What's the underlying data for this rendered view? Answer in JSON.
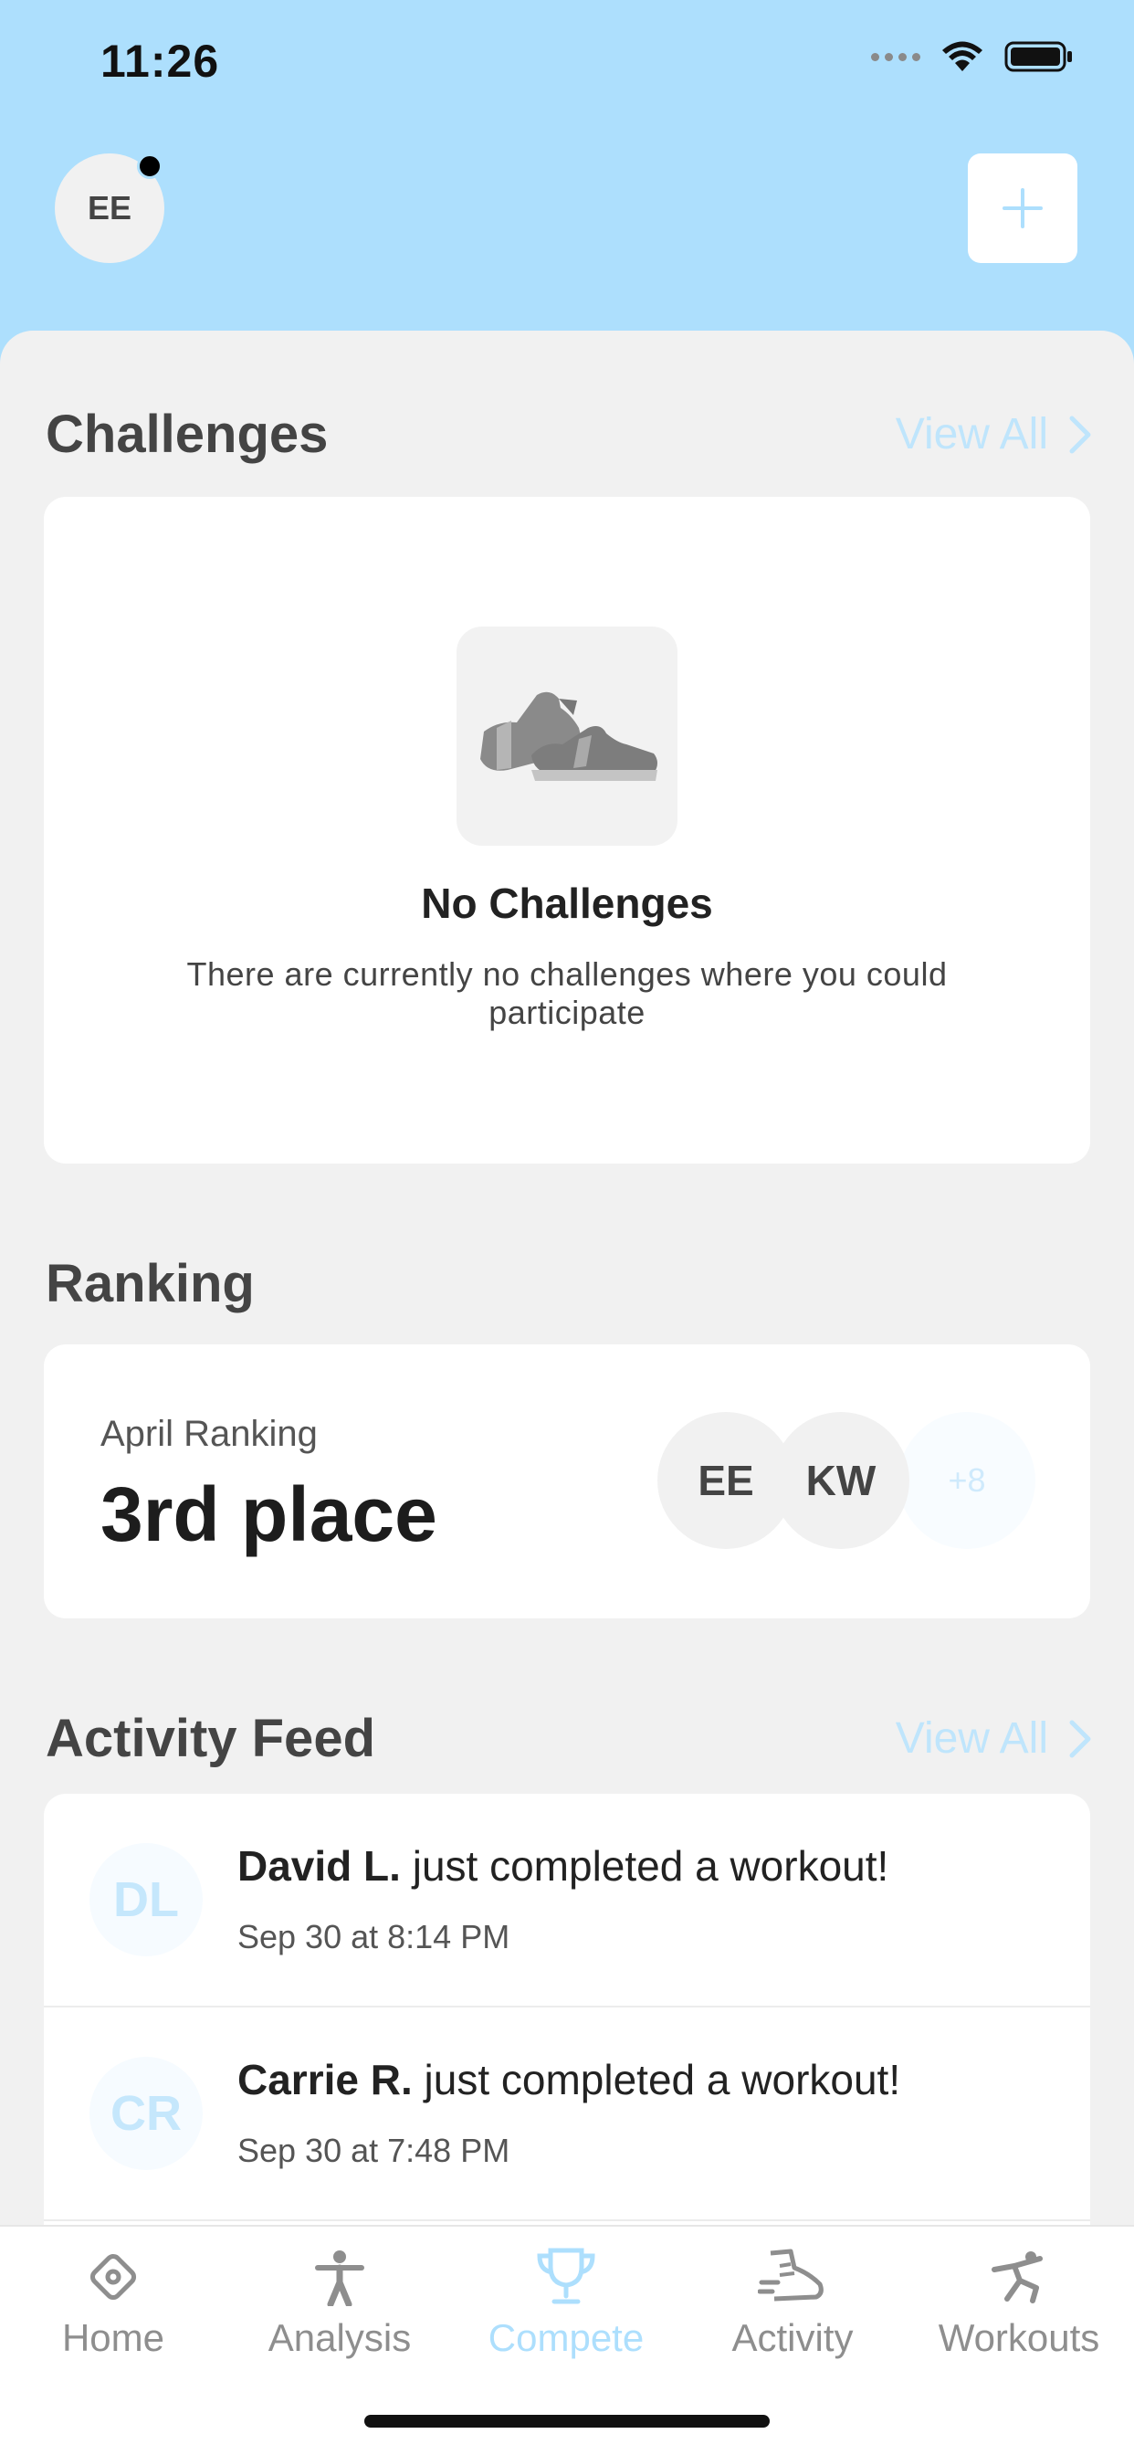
{
  "status_bar": {
    "time": "11:26"
  },
  "header": {
    "avatar_initials": "EE"
  },
  "challenges": {
    "title": "Challenges",
    "view_all": "View All",
    "empty_title": "No Challenges",
    "empty_desc": "There are currently no challenges where you could participate"
  },
  "ranking": {
    "title": "Ranking",
    "label": "April Ranking",
    "value": "3rd place",
    "avatars": [
      "EE",
      "KW"
    ],
    "more": "+8"
  },
  "feed": {
    "title": "Activity Feed",
    "view_all": "View All",
    "items": [
      {
        "initials": "DL",
        "name": "David L.",
        "action": " just completed a workout!",
        "time": "Sep 30 at 8:14 PM"
      },
      {
        "initials": "CR",
        "name": "Carrie R.",
        "action": " just completed a workout!",
        "time": "Sep 30 at 7:48 PM"
      }
    ]
  },
  "tabs": [
    {
      "label": "Home",
      "icon": "home-icon"
    },
    {
      "label": "Analysis",
      "icon": "person-icon"
    },
    {
      "label": "Compete",
      "icon": "trophy-icon",
      "active": true
    },
    {
      "label": "Activity",
      "icon": "activity-shoe-icon"
    },
    {
      "label": "Workouts",
      "icon": "workout-figure-icon"
    }
  ],
  "colors": {
    "header_bg": "#addffd",
    "accent": "#addffd",
    "muted_accent": "#bfe5fc"
  }
}
